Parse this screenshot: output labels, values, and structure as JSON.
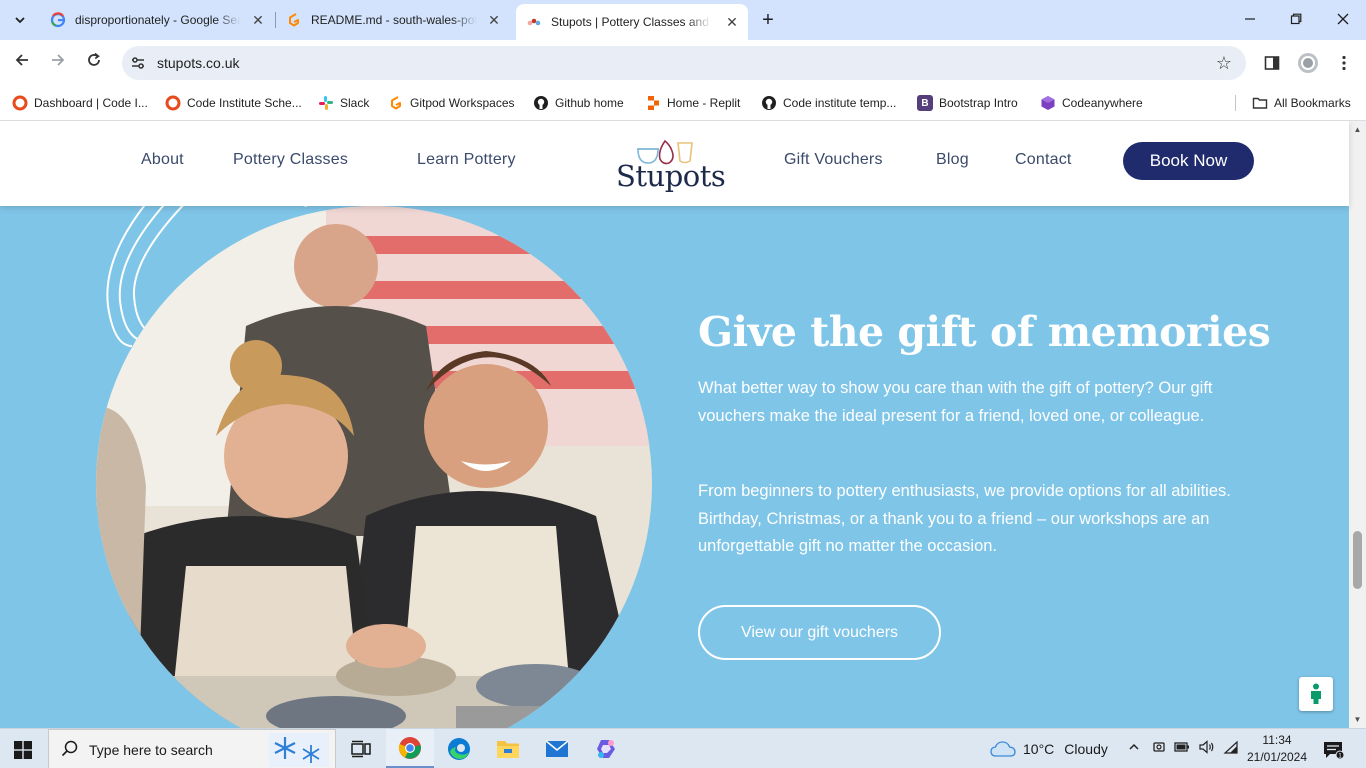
{
  "browser": {
    "tabs": [
      {
        "title": "disproportionately - Google Search",
        "favicon": "google-icon",
        "active": false
      },
      {
        "title": "README.md - south-wales-pottery",
        "favicon": "gitpod-icon",
        "active": false
      },
      {
        "title": "Stupots | Pottery Classes and Workshops",
        "favicon": "stupots-icon",
        "active": true
      }
    ],
    "url": "stupots.co.uk",
    "bookmarks": [
      {
        "label": "Dashboard | Code I...",
        "icon": "code-institute-icon"
      },
      {
        "label": "Code Institute Sche...",
        "icon": "code-institute-icon"
      },
      {
        "label": "Slack",
        "icon": "slack-icon"
      },
      {
        "label": "Gitpod Workspaces",
        "icon": "gitpod-icon"
      },
      {
        "label": "Github home",
        "icon": "github-icon"
      },
      {
        "label": "Home - Replit",
        "icon": "replit-icon"
      },
      {
        "label": "Code institute temp...",
        "icon": "github-icon"
      },
      {
        "label": "Bootstrap Intro",
        "icon": "bootstrap-icon"
      },
      {
        "label": "Codeanywhere",
        "icon": "codeanywhere-icon"
      }
    ],
    "all_bookmarks": "All Bookmarks"
  },
  "site": {
    "nav_left": [
      "About",
      "Pottery Classes",
      "Learn Pottery"
    ],
    "logo_text": "Stupots",
    "nav_right": [
      "Gift Vouchers",
      "Blog",
      "Contact"
    ],
    "book_now": "Book Now",
    "hero": {
      "title": "Give the gift of memories",
      "para1": "What better way to show you care than with the gift of pottery? Our gift vouchers make the ideal present for a friend, loved one, or colleague.",
      "para2": "From beginners to pottery enthusiasts, we provide options for all abilities. Birthday, Christmas, or a thank you to a friend – our workshops are an unforgettable gift no matter the occasion.",
      "cta": "View our gift vouchers"
    },
    "colors": {
      "hero_bg": "#7fc5e8",
      "navy": "#1f2b6c",
      "nav_text": "#3a4a6b"
    }
  },
  "taskbar": {
    "search_placeholder": "Type here to search",
    "weather_temp": "10°C",
    "weather_desc": "Cloudy",
    "time": "11:34",
    "date": "21/01/2024"
  }
}
